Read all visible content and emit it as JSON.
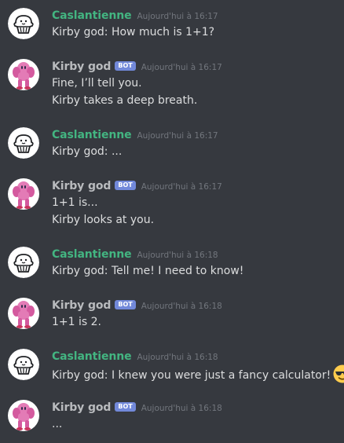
{
  "users": {
    "human": {
      "name": "Caslantienne"
    },
    "bot": {
      "name": "Kirby god",
      "tag": "BOT"
    }
  },
  "messages": [
    {
      "author": "Caslantienne",
      "is_bot": false,
      "timestamp": "Aujourd'hui à 16:17",
      "lines": [
        "Kirby god: How much is 1+1?"
      ]
    },
    {
      "author": "Kirby god",
      "is_bot": true,
      "timestamp": "Aujourd'hui à 16:17",
      "lines": [
        "Fine, I’ll tell you.",
        "Kirby takes a deep breath."
      ]
    },
    {
      "author": "Caslantienne",
      "is_bot": false,
      "timestamp": "Aujourd'hui à 16:17",
      "lines": [
        "Kirby god: ..."
      ]
    },
    {
      "author": "Kirby god",
      "is_bot": true,
      "timestamp": "Aujourd'hui à 16:17",
      "lines": [
        "1+1 is...",
        "Kirby looks at you."
      ]
    },
    {
      "author": "Caslantienne",
      "is_bot": false,
      "timestamp": "Aujourd'hui à 16:18",
      "lines": [
        "Kirby god: Tell me! I need to know!"
      ]
    },
    {
      "author": "Kirby god",
      "is_bot": true,
      "timestamp": "Aujourd'hui à 16:18",
      "lines": [
        "1+1 is 2."
      ]
    },
    {
      "author": "Caslantienne",
      "is_bot": false,
      "timestamp": "Aujourd'hui à 16:18",
      "lines": [
        "Kirby god: I knew you were just a fancy calculator!"
      ],
      "trailing_emoji": "sunglasses-emoji"
    },
    {
      "author": "Kirby god",
      "is_bot": true,
      "timestamp": "Aujourd'hui à 16:18",
      "lines": [
        "..."
      ]
    }
  ],
  "colors": {
    "background": "#36393f",
    "human_name": "#43b581",
    "bot_name": "#b9bbbe",
    "bot_tag": "#7289da",
    "timestamp": "#72767d",
    "text": "#dcddde"
  },
  "icons": {
    "human_avatar": "muffin-avatar-icon",
    "bot_avatar": "pink-kirby-avatar-icon"
  }
}
